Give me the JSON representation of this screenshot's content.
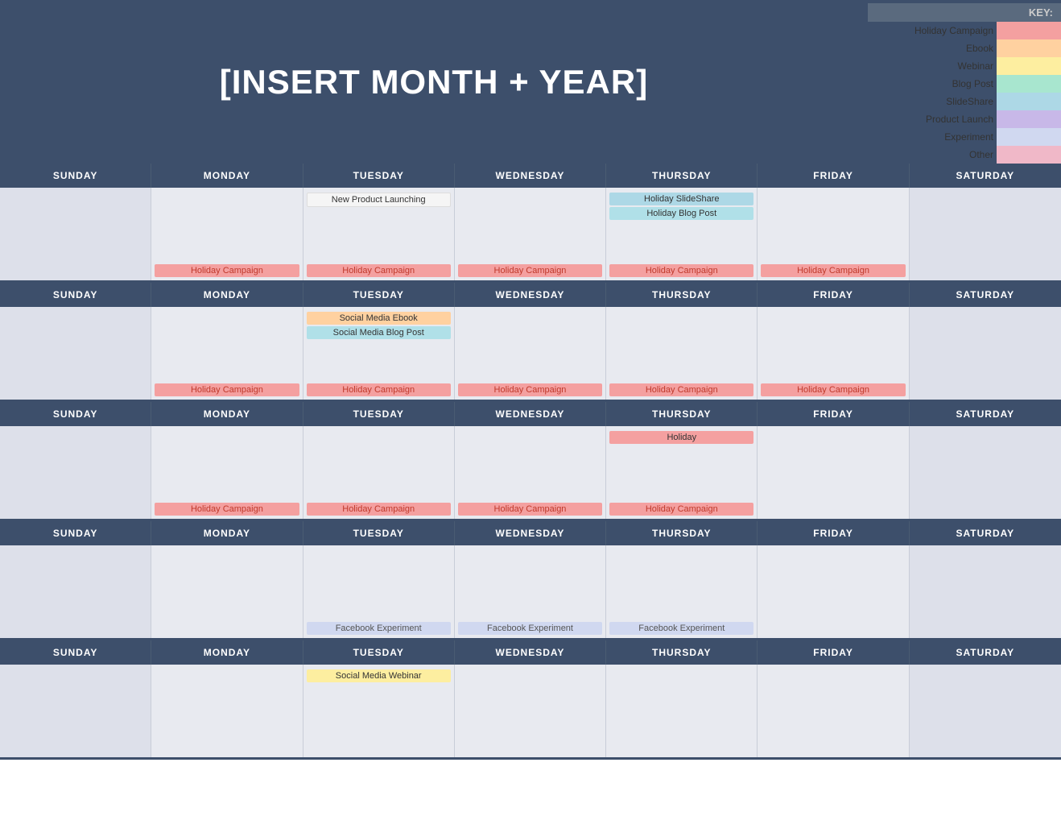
{
  "header": {
    "title": "[INSERT MONTH + YEAR]"
  },
  "key": {
    "label": "KEY:",
    "items": [
      {
        "name": "Holiday Campaign",
        "color": "#f4a0a0"
      },
      {
        "name": "Ebook",
        "color": "#ffd1a0"
      },
      {
        "name": "Webinar",
        "color": "#fdeea0"
      },
      {
        "name": "Blog Post",
        "color": "#a8e6cf"
      },
      {
        "name": "SlideShare",
        "color": "#add8e6"
      },
      {
        "name": "Product Launch",
        "color": "#c8b8e8"
      },
      {
        "name": "Experiment",
        "color": "#d0d8f0"
      },
      {
        "name": "Other",
        "color": "#f0b8c8"
      }
    ]
  },
  "days": {
    "headers": [
      "SUNDAY",
      "MONDAY",
      "TUESDAY",
      "WEDNESDAY",
      "THURSDAY",
      "FRIDAY",
      "SATURDAY"
    ]
  },
  "weeks": [
    {
      "id": "week1",
      "cells": [
        {
          "day": "sunday",
          "events": [],
          "footer": ""
        },
        {
          "day": "monday",
          "events": [],
          "footer": "Holiday Campaign"
        },
        {
          "day": "tuesday",
          "events": [
            "New Product Launching"
          ],
          "footer": "Holiday Campaign"
        },
        {
          "day": "wednesday",
          "events": [],
          "footer": "Holiday Campaign"
        },
        {
          "day": "thursday",
          "events": [
            "Holiday SlideShare",
            "Holiday Blog Post"
          ],
          "footer": "Holiday Campaign"
        },
        {
          "day": "friday",
          "events": [],
          "footer": "Holiday Campaign"
        },
        {
          "day": "saturday",
          "events": [],
          "footer": ""
        }
      ]
    },
    {
      "id": "week2",
      "cells": [
        {
          "day": "sunday",
          "events": [],
          "footer": ""
        },
        {
          "day": "monday",
          "events": [],
          "footer": "Holiday Campaign"
        },
        {
          "day": "tuesday",
          "events": [
            "Social Media Ebook",
            "Social Media Blog Post"
          ],
          "footer": "Holiday Campaign"
        },
        {
          "day": "wednesday",
          "events": [],
          "footer": "Holiday Campaign"
        },
        {
          "day": "thursday",
          "events": [],
          "footer": "Holiday Campaign"
        },
        {
          "day": "friday",
          "events": [],
          "footer": "Holiday Campaign"
        },
        {
          "day": "saturday",
          "events": [],
          "footer": ""
        }
      ]
    },
    {
      "id": "week3",
      "cells": [
        {
          "day": "sunday",
          "events": [],
          "footer": ""
        },
        {
          "day": "monday",
          "events": [],
          "footer": "Holiday Campaign"
        },
        {
          "day": "tuesday",
          "events": [],
          "footer": "Holiday Campaign"
        },
        {
          "day": "wednesday",
          "events": [],
          "footer": "Holiday Campaign"
        },
        {
          "day": "thursday",
          "events": [
            "Holiday"
          ],
          "footer": "Holiday Campaign"
        },
        {
          "day": "friday",
          "events": [],
          "footer": ""
        },
        {
          "day": "saturday",
          "events": [],
          "footer": ""
        }
      ]
    },
    {
      "id": "week4",
      "cells": [
        {
          "day": "sunday",
          "events": [],
          "footer": ""
        },
        {
          "day": "monday",
          "events": [],
          "footer": ""
        },
        {
          "day": "tuesday",
          "events": [],
          "footer": "Facebook Experiment"
        },
        {
          "day": "wednesday",
          "events": [],
          "footer": "Facebook Experiment"
        },
        {
          "day": "thursday",
          "events": [],
          "footer": "Facebook Experiment"
        },
        {
          "day": "friday",
          "events": [],
          "footer": ""
        },
        {
          "day": "saturday",
          "events": [],
          "footer": ""
        }
      ]
    },
    {
      "id": "week5",
      "cells": [
        {
          "day": "sunday",
          "events": [],
          "footer": ""
        },
        {
          "day": "monday",
          "events": [],
          "footer": ""
        },
        {
          "day": "tuesday",
          "events": [
            "Social Media Webinar"
          ],
          "footer": ""
        },
        {
          "day": "wednesday",
          "events": [],
          "footer": ""
        },
        {
          "day": "thursday",
          "events": [],
          "footer": ""
        },
        {
          "day": "friday",
          "events": [],
          "footer": ""
        },
        {
          "day": "saturday",
          "events": [],
          "footer": ""
        }
      ]
    }
  ]
}
